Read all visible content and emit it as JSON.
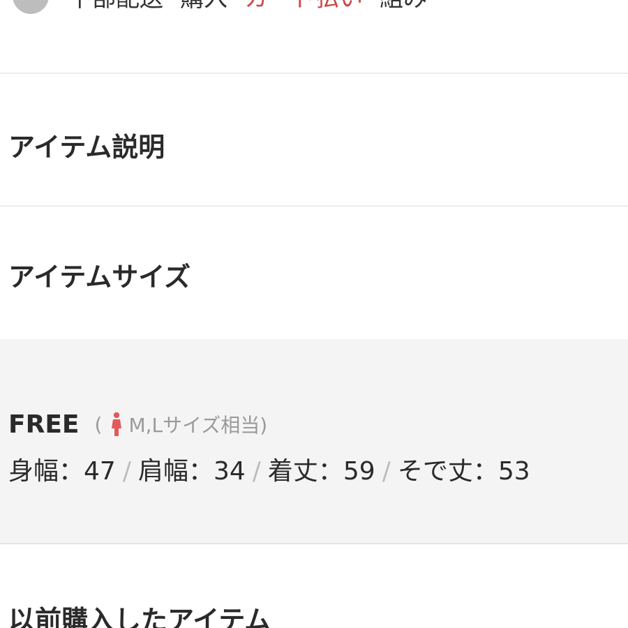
{
  "top_partial": {
    "text_left": "下部配送",
    "text_mid": "購入",
    "text_red": "カード払い",
    "text_right": "組み"
  },
  "sections": {
    "description_title": "アイテム説明",
    "size_title": "アイテムサイズ",
    "history_title": "以前購入したアイテム"
  },
  "size_info": {
    "size_name": "FREE",
    "note_open": "(",
    "note_text": "M,Lサイズ相当)",
    "icon": "woman-icon",
    "icon_color": "#e05a5a",
    "measurements": [
      "身幅：47",
      "肩幅：34",
      "着丈：59",
      "そで丈：53"
    ],
    "separator": "/"
  },
  "colors": {
    "accent_red": "#c94a4a",
    "panel_bg": "#f4f4f4",
    "divider": "#ececec"
  }
}
